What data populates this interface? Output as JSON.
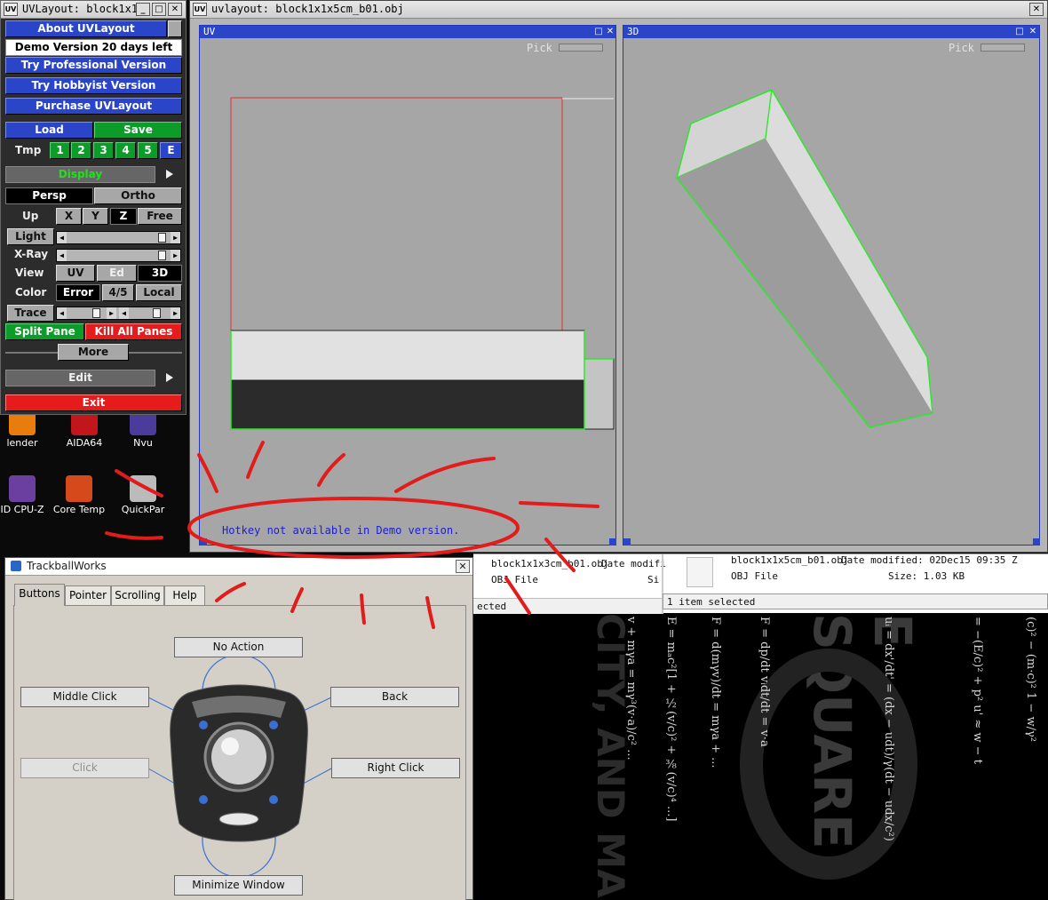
{
  "desktop": {
    "icons": [
      {
        "label": "lender",
        "icon": "blender-icon",
        "color": "#e87d0d"
      },
      {
        "label": "AIDA64",
        "icon": "aida64-icon",
        "color": "#c0161c"
      },
      {
        "label": "Nvu",
        "icon": "nvu-icon",
        "color": "#4b3b9a"
      },
      {
        "label": "ID CPU-Z",
        "icon": "cpuz-icon",
        "color": "#6b3fa0"
      },
      {
        "label": "Core Temp",
        "icon": "core-temp-icon",
        "color": "#d44a1b"
      },
      {
        "label": "QuickPar",
        "icon": "quickpar-icon",
        "color": "#bbbbbb"
      }
    ]
  },
  "uvpanel": {
    "title": "UVLayout: block1x1x...",
    "window_icon": "UV",
    "about": "About UVLayout",
    "demo": "Demo Version 20 days left",
    "try_pro": "Try Professional Version",
    "try_hobbyist": "Try Hobbyist Version",
    "purchase": "Purchase UVLayout",
    "load": "Load",
    "save": "Save",
    "tmp_label": "Tmp",
    "tmp_slots": [
      "1",
      "2",
      "3",
      "4",
      "5",
      "E"
    ],
    "display": "Display",
    "persp": "Persp",
    "ortho": "Ortho",
    "up_label": "Up",
    "axes": [
      "X",
      "Y",
      "Z",
      "Free"
    ],
    "light": "Light",
    "light_level": 0.95,
    "xray": "X-Ray",
    "xray_level": 0.95,
    "view_label": "View",
    "view_options": [
      "UV",
      "Ed",
      "3D"
    ],
    "color_label": "Color",
    "color_options": [
      "Error",
      "4/5",
      "Local"
    ],
    "trace": "Trace",
    "split_pane": "Split Pane",
    "kill_all": "Kill All Panes",
    "more": "More",
    "edit": "Edit",
    "exit": "Exit",
    "colors": {
      "blue": "#2a45c8",
      "green": "#0c9c2a",
      "red": "#e61b1b"
    }
  },
  "main": {
    "title": "uvlayout: block1x1x5cm_b01.obj",
    "close": "✕",
    "uv_pane": {
      "label": "UV",
      "pick": "Pick",
      "hotkey_msg": "Hotkey not available in Demo version."
    },
    "pane3d": {
      "label": "3D",
      "pick": "Pick"
    }
  },
  "explorer": {
    "left_file": "block1x1x3cm_b01.obj",
    "left_date": "Date modifi",
    "left_type": "OBJ File",
    "left_size": "Si",
    "right_file": "block1x1x5cm_b01.obj",
    "right_date": "Date modified: 02Dec15 09:35 Z",
    "right_type": "OBJ File",
    "right_size": "Size: 1.03 KB",
    "status_left": "ected",
    "status_right": "1 item selected"
  },
  "trackball": {
    "title": "TrackballWorks",
    "tabs": [
      "Buttons",
      "Pointer",
      "Scrolling",
      "Help"
    ],
    "active_tab": "Buttons",
    "buttons": {
      "top": "No Action",
      "upper_left": "Middle Click",
      "upper_right": "Back",
      "lower_left": "Click",
      "lower_right": "Right Click",
      "bottom": "Minimize Window"
    }
  }
}
